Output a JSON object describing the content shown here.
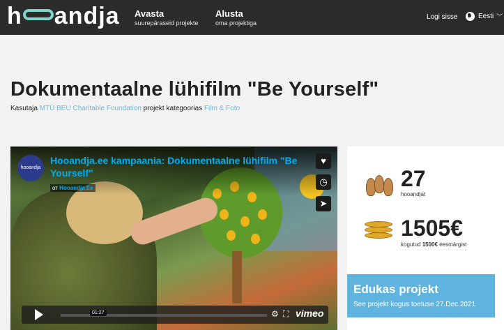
{
  "nav": {
    "logo": "hooandja",
    "discover_title": "Avasta",
    "discover_sub": "suurepäraseid projekte",
    "start_title": "Alusta",
    "start_sub": "oma projektiga",
    "login": "Logi sisse",
    "language": "Eesti"
  },
  "project": {
    "title": "Dokumentaalne lühifilm \"Be Yourself\"",
    "by_prefix": "Kasutaja",
    "author": "MTÜ BEU Charitable Foundation",
    "category_prefix": "projekt kategoorias",
    "category": "Film & Foto"
  },
  "video": {
    "title": "Hooandja.ee kampaania: Dokumentaalne lühifilm \"Be Yourself\"",
    "by_prefix": "от",
    "by_name": "Hooandja Ee",
    "avatar_text": "hooandja",
    "time": "01:27",
    "brand": "vimeo"
  },
  "stats": {
    "backers_value": "27",
    "backers_label": "hooandjat",
    "raised_value": "1505€",
    "raised_label_prefix": "kogutud",
    "raised_goal": "1500€",
    "raised_label_suffix": "eesmärgist"
  },
  "status": {
    "title": "Edukas projekt",
    "detail": "See projekt kogus toetuse 27.Dec.2021"
  },
  "icons": {
    "like": "heart-icon",
    "watch_later": "clock-icon",
    "share": "paper-plane-icon",
    "settings": "gear-icon",
    "fullscreen": "fullscreen-icon",
    "language": "globe-icon"
  },
  "colors": {
    "nav_bg": "#2b2b2b",
    "accent_teal": "#7fd4cc",
    "link_blue": "#6fb8d6",
    "success_blue": "#5fb4df",
    "vimeo_blue": "#00adef"
  }
}
